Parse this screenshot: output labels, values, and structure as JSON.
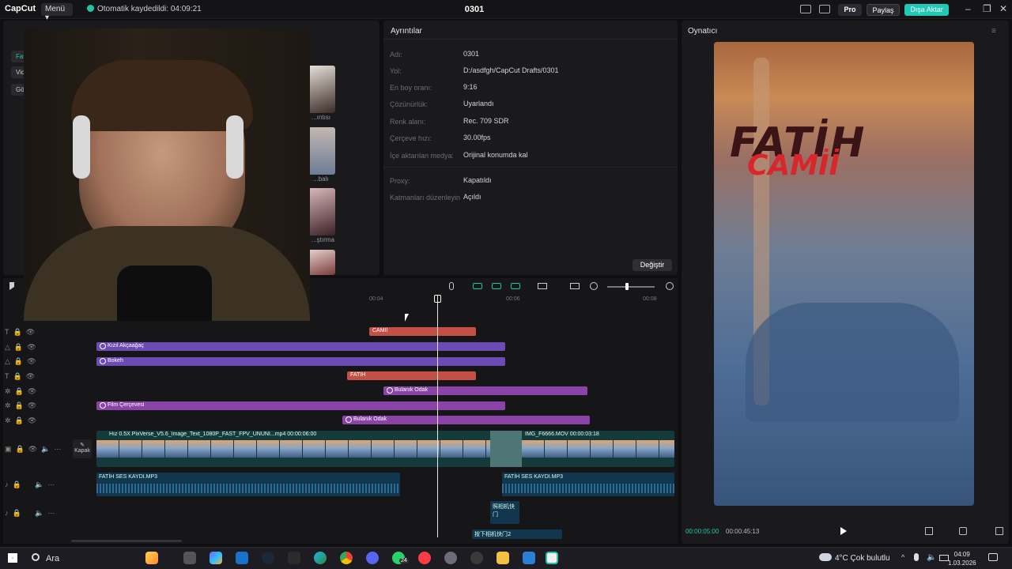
{
  "titlebar": {
    "logo": "CapCut",
    "menu": "Menü",
    "autosave": "Otomatik kaydedildi: 04:09:21",
    "project": "0301",
    "pro": "Pro",
    "share": "Paylaş",
    "export": "Dışa Aktar"
  },
  "media": {
    "side_tabs": [
      "Fav",
      "Vide",
      "Göv"
    ],
    "thumbs": [
      "...ıntısı",
      "...balı",
      "...ştırma"
    ]
  },
  "details": {
    "title": "Ayrıntılar",
    "rows": [
      {
        "label": "Adı:",
        "value": "0301"
      },
      {
        "label": "Yol:",
        "value": "D:/asdfgh/CapCut Drafts/0301"
      },
      {
        "label": "En boy oranı:",
        "value": "9:16"
      },
      {
        "label": "Çözünürlük:",
        "value": "Uyarlandı"
      },
      {
        "label": "Renk alanı:",
        "value": "Rec. 709 SDR"
      },
      {
        "label": "Çerçeve hızı:",
        "value": "30.00fps"
      },
      {
        "label": "İçe aktarılan medya:",
        "value": "Orijinal konumda kal"
      }
    ],
    "rows2": [
      {
        "label": "Proxy:",
        "value": "Kapatıldı"
      },
      {
        "label": "Katmanları düzenleyin",
        "value": "Açıldı"
      }
    ],
    "change": "Değiştir"
  },
  "player": {
    "title": "Oynatıcı",
    "line1": "FATİH",
    "line2": "CAMİİ",
    "time_current": "00:00:05:00",
    "time_total": "00:00:45:13"
  },
  "timeline": {
    "ruler": [
      "00:04",
      "00:06",
      "00:08"
    ],
    "clips": {
      "camii": "CAMİİ",
      "kizil": "Kızıl Akçaağaç",
      "bokeh": "Bokeh",
      "fatih": "FATİH",
      "bulanik1": "Bulanık Odak",
      "film": "Film Çerçevesi",
      "bulanik2": "Bulanık Odak"
    },
    "cover": "Kapak",
    "video1": "Hız 0.5X   PixVerse_V5.6_Image_Text_1080P_FAST_FPV_UNUNI...mp4   00:00:06:00",
    "video2": "IMG_F6666.MOV   00:00:03:18",
    "audio1": "FATİH SES KAYDI.MP3",
    "audio2": "FATİH SES KAYDI.MP3",
    "audio3": "照相机快门",
    "audio4": "按下相机快门2"
  },
  "taskbar": {
    "search": "Ara",
    "weather": "4°C  Çok bulutlu",
    "time": "04:09",
    "date": "1.03.2026",
    "whatsapp_badge": "24"
  },
  "colors": {
    "accent": "#22c3a6",
    "text_clip": "#c44f45",
    "effect_clip": "#6c4bb5",
    "filter_clip": "#8a44a8"
  }
}
